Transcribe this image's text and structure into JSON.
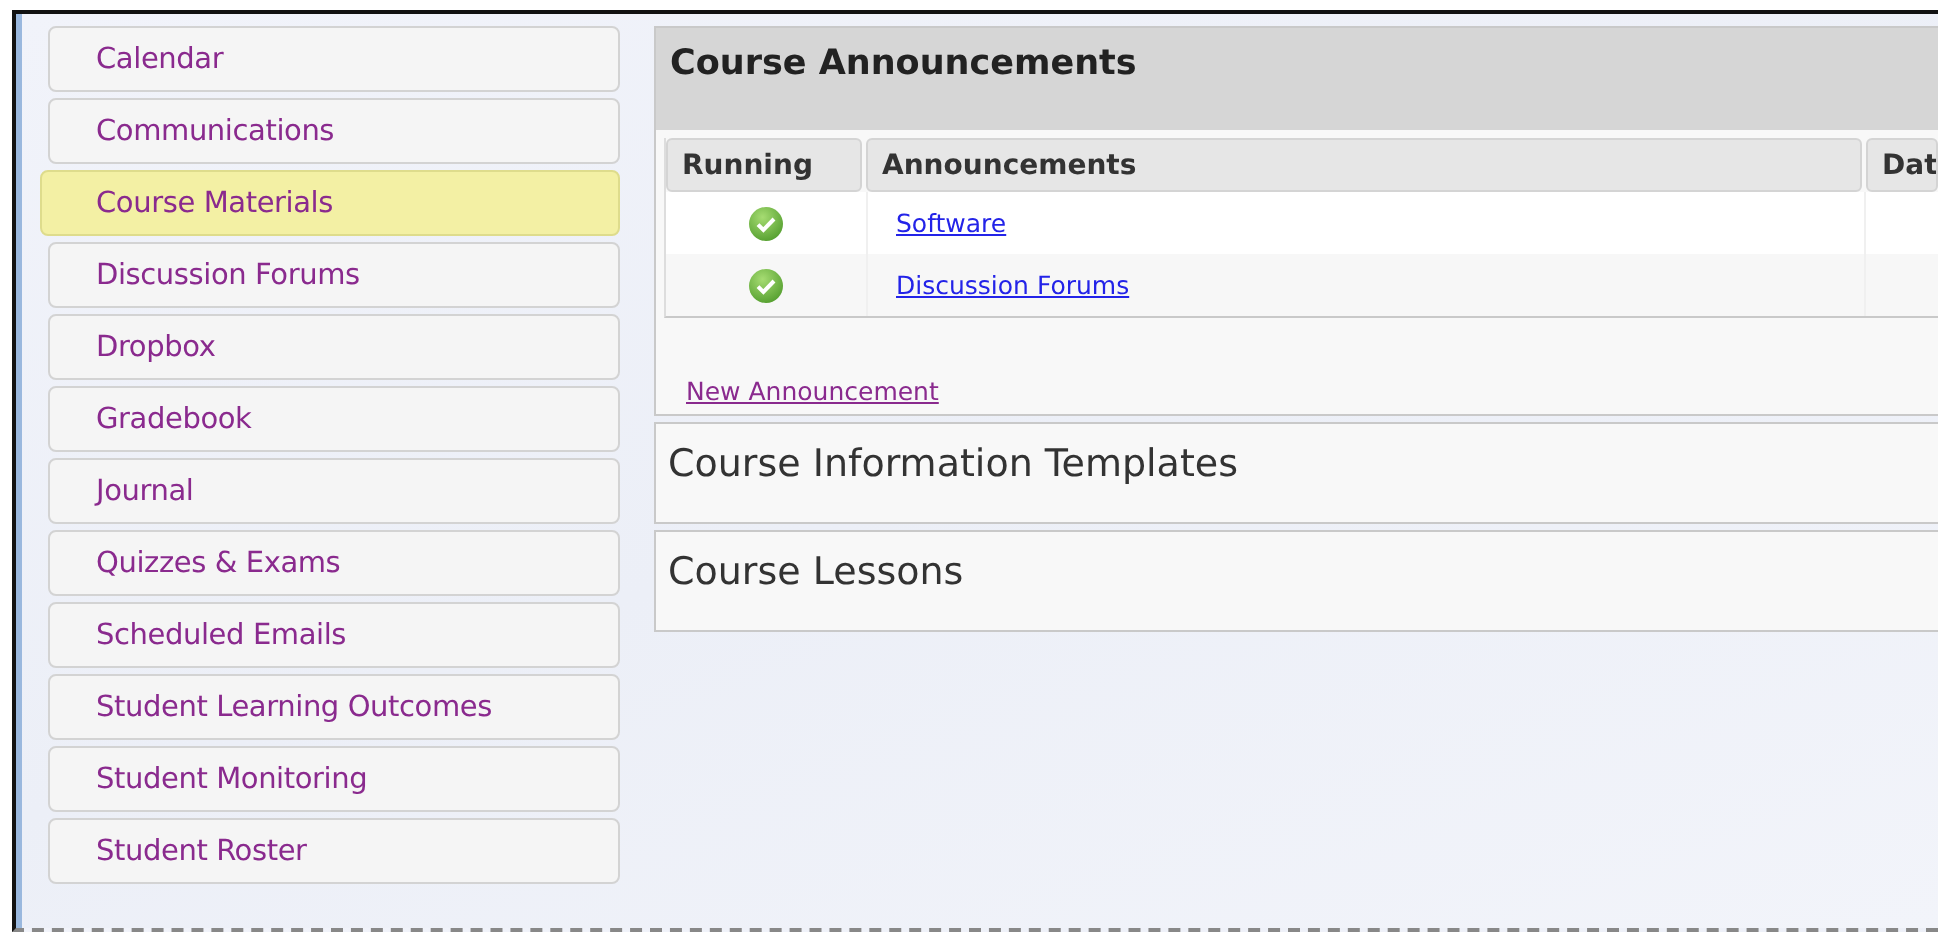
{
  "sidebar": {
    "items": [
      {
        "label": "Calendar",
        "selected": false
      },
      {
        "label": "Communications",
        "selected": false
      },
      {
        "label": "Course Materials",
        "selected": true
      },
      {
        "label": "Discussion Forums",
        "selected": false
      },
      {
        "label": "Dropbox",
        "selected": false
      },
      {
        "label": "Gradebook",
        "selected": false
      },
      {
        "label": "Journal",
        "selected": false
      },
      {
        "label": "Quizzes & Exams",
        "selected": false
      },
      {
        "label": "Scheduled Emails",
        "selected": false
      },
      {
        "label": "Student Learning Outcomes",
        "selected": false
      },
      {
        "label": "Student Monitoring",
        "selected": false
      },
      {
        "label": "Student Roster",
        "selected": false
      }
    ]
  },
  "announcements": {
    "title": "Course Announcements",
    "table": {
      "columns": [
        "Running",
        "Announcements",
        "Dat"
      ],
      "rows": [
        {
          "running": true,
          "title": "Software"
        },
        {
          "running": true,
          "title": "Discussion Forums"
        }
      ]
    },
    "new_link": "New Announcement"
  },
  "sections": [
    {
      "title": "Course Information Templates"
    },
    {
      "title": "Course Lessons"
    }
  ]
}
